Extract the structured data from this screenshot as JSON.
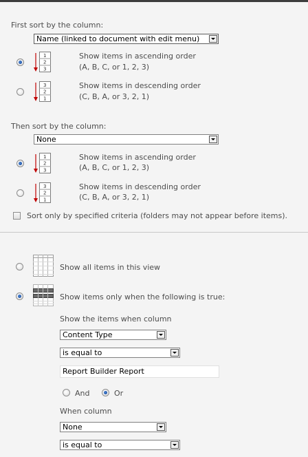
{
  "sort": {
    "first": {
      "label": "First sort by the column:",
      "selected": "Name (linked to document with edit menu)",
      "asc_line1": "Show items in ascending order",
      "asc_line2": "(A, B, C, or 1, 2, 3)",
      "desc_line1": "Show items in descending order",
      "desc_line2": "(C, B, A, or 3, 2, 1)",
      "order": "ascending"
    },
    "then": {
      "label": "Then sort by the column:",
      "selected": "None",
      "asc_line1": "Show items in ascending order",
      "asc_line2": "(A, B, C, or 1, 2, 3)",
      "desc_line1": "Show items in descending order",
      "desc_line2": "(C, B, A, or 3, 2, 1)",
      "order": "ascending"
    },
    "criteria_only": "Sort only by specified criteria (folders may not appear before items).",
    "icon_digits_asc": [
      "1",
      "2",
      "3"
    ],
    "icon_digits_desc": [
      "3",
      "2",
      "1"
    ]
  },
  "filter": {
    "show_all": "Show all items in this view",
    "show_when": "Show items only when the following is true:",
    "selected_option": "show_when",
    "cond1": {
      "label": "Show the items when column",
      "column": "Content Type",
      "operator": "is equal to",
      "value": "Report Builder Report"
    },
    "and_label": "And",
    "or_label": "Or",
    "logic": "Or",
    "cond2": {
      "label": "When column",
      "column": "None",
      "operator": "is equal to"
    }
  },
  "colors": {
    "background": "#f4f4f4",
    "text": "#4c4c4c",
    "arrow_red": "#c00000"
  }
}
